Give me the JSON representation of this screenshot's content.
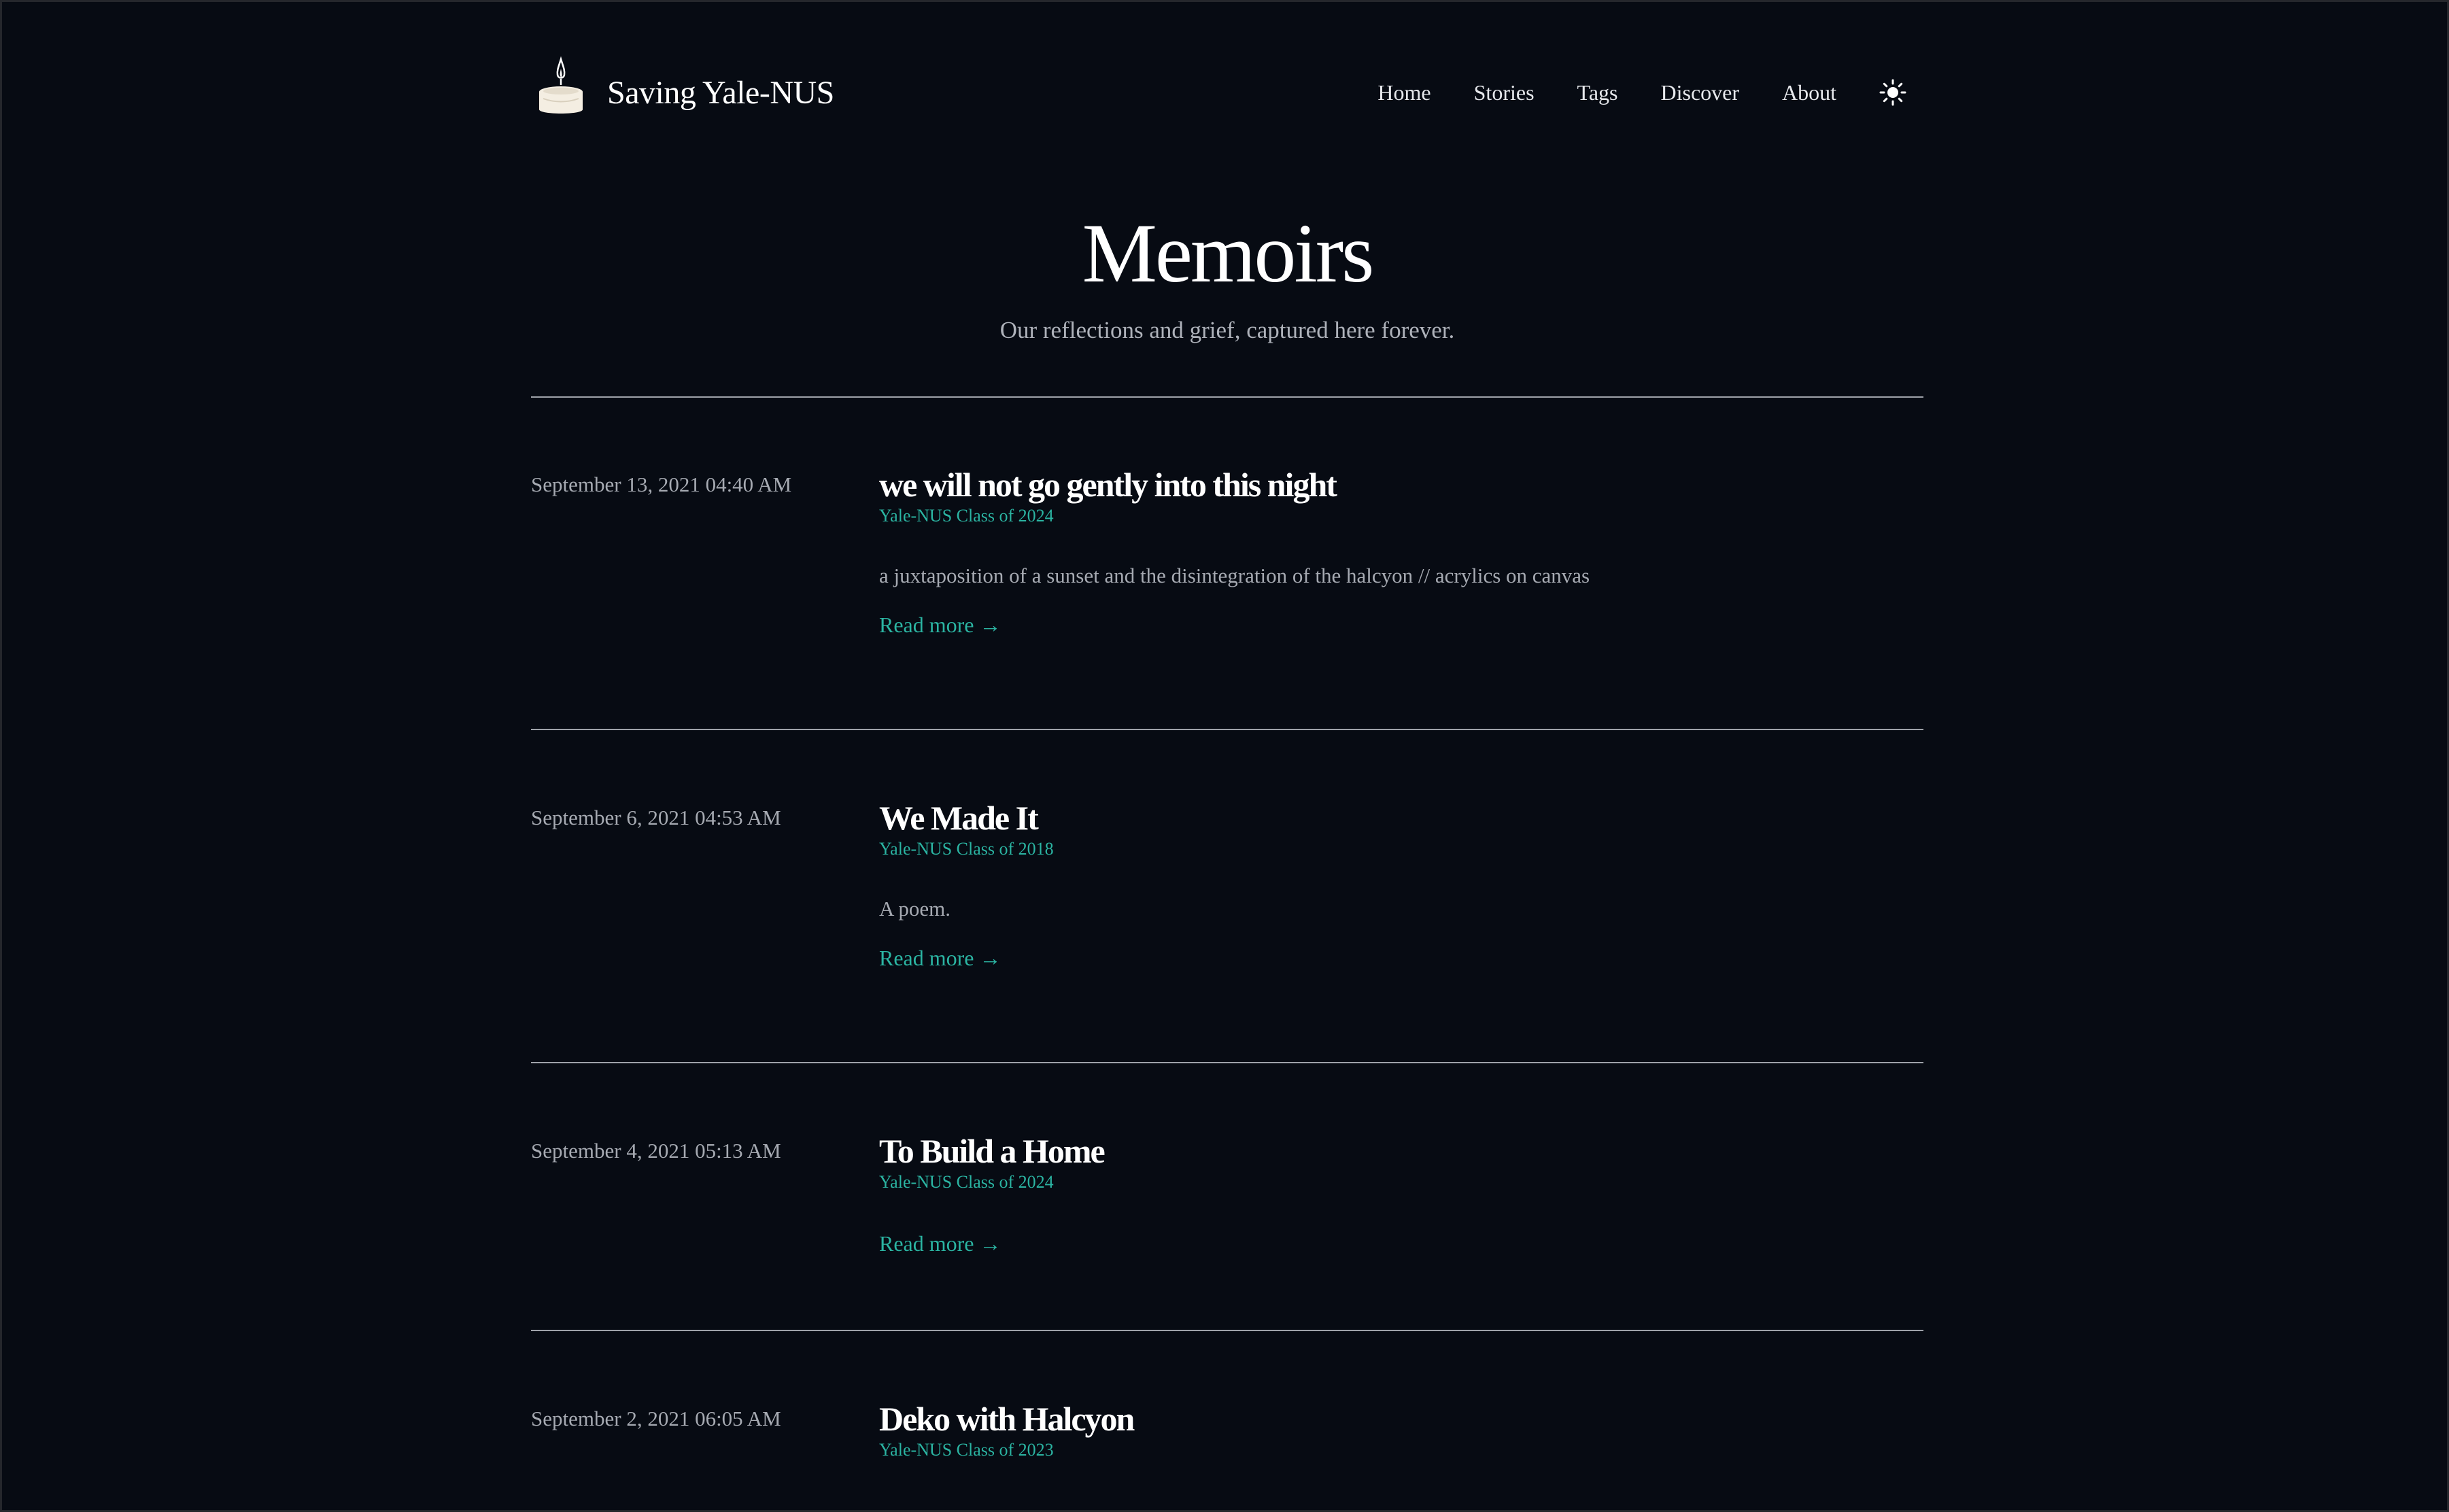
{
  "site": {
    "title": "Saving Yale-NUS",
    "logo_icon": "candle-icon"
  },
  "nav": {
    "items": [
      {
        "label": "Home"
      },
      {
        "label": "Stories"
      },
      {
        "label": "Tags"
      },
      {
        "label": "Discover"
      },
      {
        "label": "About"
      }
    ],
    "theme_toggle_icon": "sun-icon"
  },
  "hero": {
    "title": "Memoirs",
    "subtitle": "Our reflections and grief, captured here forever."
  },
  "posts": [
    {
      "date": "September 13, 2021 04:40 AM",
      "title": "we will not go gently into this night",
      "author": "Yale-NUS Class of 2024",
      "summary": "a juxtaposition of a sunset and the disintegration of the halcyon // acrylics on canvas",
      "read_more": "Read more →"
    },
    {
      "date": "September 6, 2021 04:53 AM",
      "title": "We Made It",
      "author": "Yale-NUS Class of 2018",
      "summary": "A poem.",
      "read_more": "Read more →"
    },
    {
      "date": "September 4, 2021 05:13 AM",
      "title": "To Build a Home",
      "author": "Yale-NUS Class of 2024",
      "summary": "",
      "read_more": "Read more →"
    },
    {
      "date": "September 2, 2021 06:05 AM",
      "title": "Deko with Halcyon",
      "author": "Yale-NUS Class of 2023",
      "summary": "",
      "read_more": ""
    }
  ],
  "colors": {
    "background": "#070b13",
    "accent": "#2bb4a2",
    "muted_text": "#a6aab2",
    "divider": "#9ea2a9"
  }
}
